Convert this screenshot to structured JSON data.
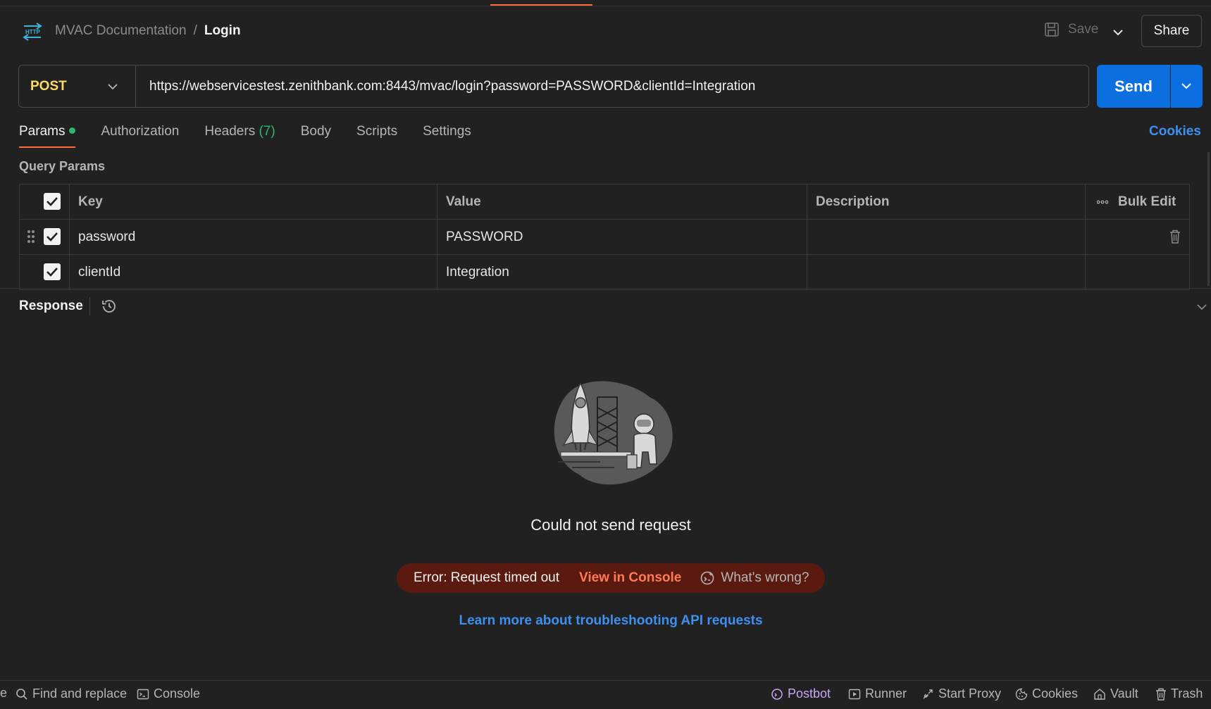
{
  "header": {
    "breadcrumb_parent": "MVAC Documentation",
    "breadcrumb_sep": "/",
    "breadcrumb_current": "Login",
    "save_label": "Save",
    "share_label": "Share"
  },
  "request": {
    "method": "POST",
    "url": "https://webservicestest.zenithbank.com:8443/mvac/login?password=PASSWORD&clientId=Integration",
    "send_label": "Send"
  },
  "tabs": [
    {
      "label": "Params",
      "active": true
    },
    {
      "label": "Authorization"
    },
    {
      "label": "Headers",
      "count": "(7)"
    },
    {
      "label": "Body"
    },
    {
      "label": "Scripts"
    },
    {
      "label": "Settings"
    }
  ],
  "cookies_label": "Cookies",
  "query_params": {
    "title": "Query Params",
    "headers": {
      "key": "Key",
      "value": "Value",
      "description": "Description",
      "bulk_edit": "Bulk Edit"
    },
    "rows": [
      {
        "key": "password",
        "value": "PASSWORD",
        "description": "",
        "checked": true
      },
      {
        "key": "clientId",
        "value": "Integration",
        "description": "",
        "checked": true
      }
    ]
  },
  "response": {
    "title": "Response",
    "message": "Could not send request",
    "error_text": "Error: Request timed out",
    "view_console": "View in Console",
    "whats_wrong": "What's wrong?",
    "learn_more": "Learn more about troubleshooting API requests"
  },
  "footer": {
    "find_replace": "Find and replace",
    "console": "Console",
    "postbot": "Postbot",
    "runner": "Runner",
    "start_proxy": "Start Proxy",
    "cookies": "Cookies",
    "vault": "Vault",
    "trash": "Trash",
    "left_edge": "e"
  },
  "colors": {
    "accent": "#ff6c37",
    "send": "#0b6fe0",
    "method": "#ffd966",
    "link": "#3d8ff0",
    "error_bg": "#5a1a10"
  }
}
